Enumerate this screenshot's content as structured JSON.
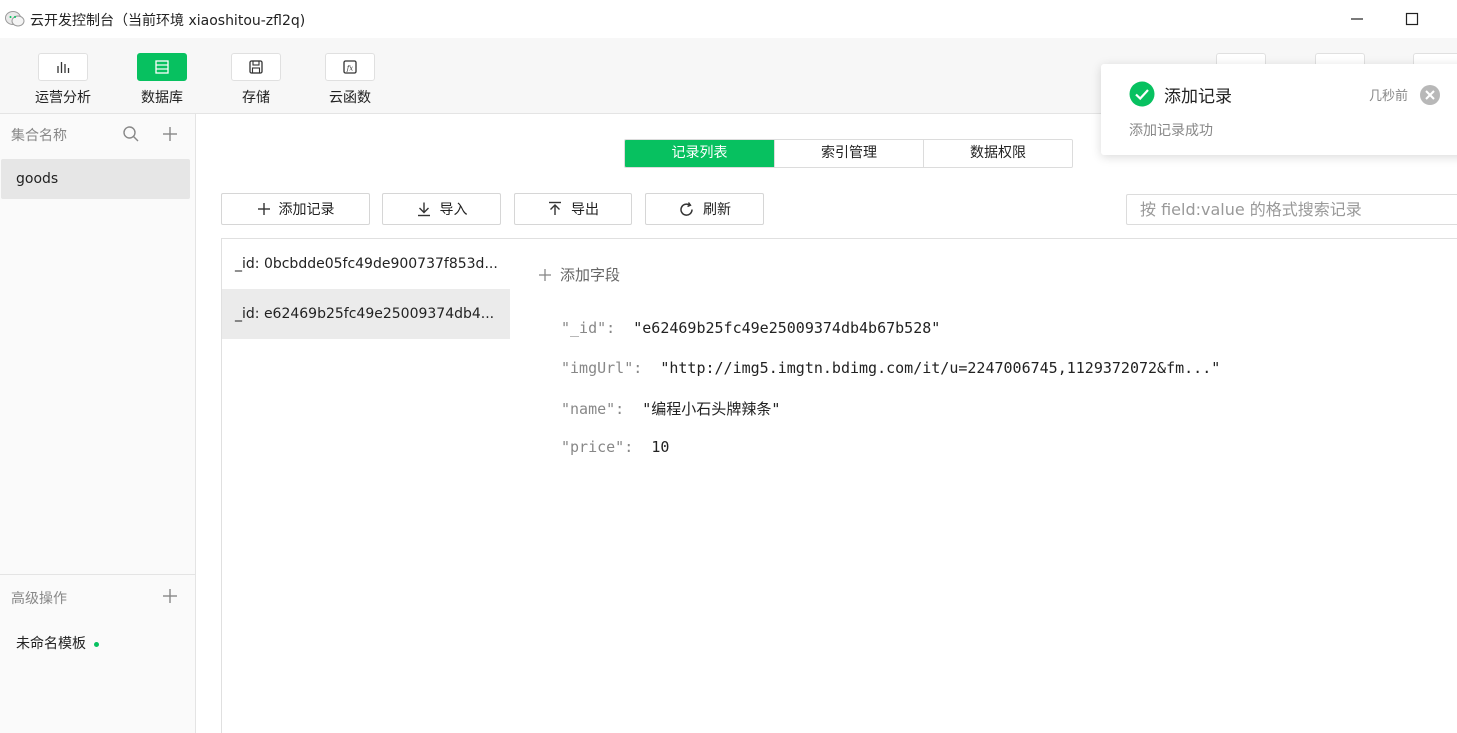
{
  "window": {
    "title": "云开发控制台（当前环境 xiaoshitou-zfl2q)"
  },
  "toolbar": {
    "items": [
      {
        "label": "运营分析",
        "icon": "bar-chart-icon"
      },
      {
        "label": "数据库",
        "icon": "database-icon"
      },
      {
        "label": "存储",
        "icon": "save-icon"
      },
      {
        "label": "云函数",
        "icon": "function-icon"
      }
    ],
    "active": "数据库"
  },
  "sidebar": {
    "collections_header": "集合名称",
    "collections": [
      "goods"
    ],
    "advanced_header": "高级操作",
    "template": "未命名模板"
  },
  "tabs": [
    "记录列表",
    "索引管理",
    "数据权限"
  ],
  "actions": {
    "add": "添加记录",
    "import": "导入",
    "export": "导出",
    "refresh": "刷新"
  },
  "search": {
    "placeholder": "按 field:value 的格式搜索记录"
  },
  "records": [
    "_id: 0bcbdde05fc49de900737f853d...",
    "_id: e62469b25fc49e25009374db4..."
  ],
  "detail": {
    "add_field": "添加字段",
    "fields": [
      {
        "key": "\"_id\":",
        "value": "\"e62469b25fc49e25009374db4b67b528\""
      },
      {
        "key": "\"imgUrl\":",
        "value": "\"http://img5.imgtn.bdimg.com/it/u=2247006745,1129372072&fm...\""
      },
      {
        "key": "\"name\":",
        "value": "\"编程小石头牌辣条\""
      },
      {
        "key": "\"price\":",
        "value": "10"
      }
    ]
  },
  "toast": {
    "title": "添加记录",
    "time": "几秒前",
    "message": "添加记录成功"
  },
  "colors": {
    "accent": "#07c160"
  }
}
